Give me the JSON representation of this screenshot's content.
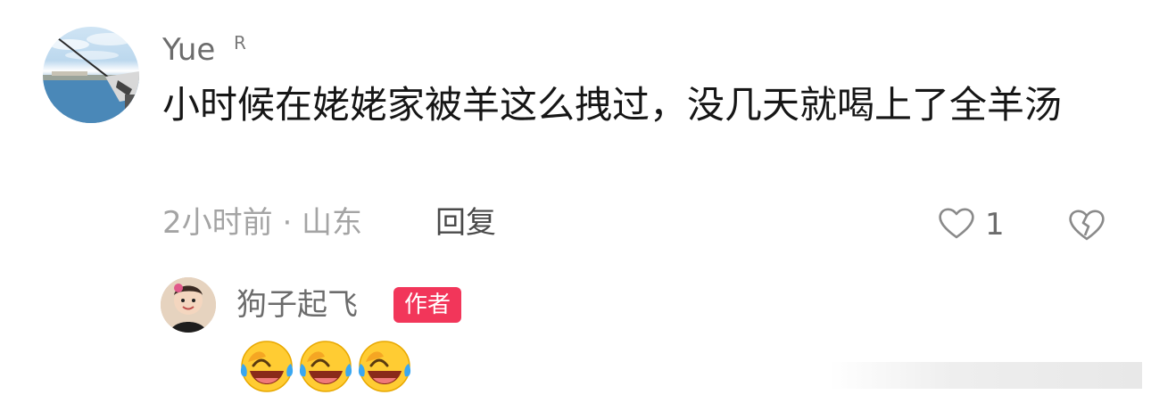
{
  "comment": {
    "username": "Yue",
    "user_badge": "R",
    "text": "小时候在姥姥家被羊这么拽过，没几天就喝上了全羊汤",
    "time_location": "2小时前 · 山东",
    "reply_label": "回复",
    "like_count": "1"
  },
  "reply": {
    "username": "狗子起飞",
    "author_tag": "作者",
    "emojis": [
      "crying-laughing",
      "crying-laughing",
      "crying-laughing"
    ]
  },
  "colors": {
    "author_tag_bg": "#f2365a",
    "text_primary": "#161616",
    "text_secondary": "#6c6c6c",
    "text_muted": "#a4a4a4"
  }
}
